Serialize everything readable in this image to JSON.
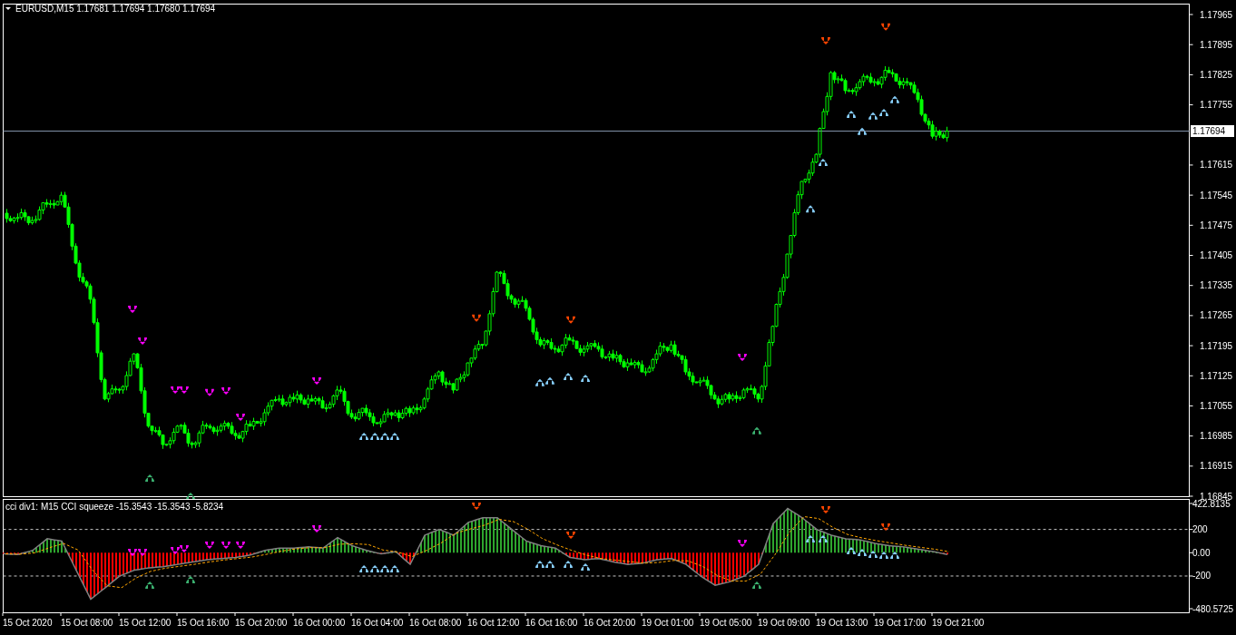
{
  "main_chart": {
    "title": "EURUSD,M15  1.17681 1.17694 1.17680 1.17694",
    "current_price": "1.17694",
    "price_axis": [
      "1.17965",
      "1.17895",
      "1.17825",
      "1.17755",
      "1.17615",
      "1.17545",
      "1.17475",
      "1.17405",
      "1.17335",
      "1.17265",
      "1.17195",
      "1.17125",
      "1.17055",
      "1.16985",
      "1.16915",
      "1.16845"
    ]
  },
  "indicator": {
    "title": "cci div1: M15 CCI squeeze -15.3543 -15.3543 -5.8234",
    "value_axis": [
      "422.8135",
      "200",
      "0.00",
      "-200",
      "-480.5725"
    ]
  },
  "time_axis": [
    "15 Oct 2020",
    "15 Oct 08:00",
    "15 Oct 12:00",
    "15 Oct 16:00",
    "15 Oct 20:00",
    "16 Oct 00:00",
    "16 Oct 04:00",
    "16 Oct 08:00",
    "16 Oct 12:00",
    "16 Oct 16:00",
    "16 Oct 20:00",
    "19 Oct 01:00",
    "19 Oct 05:00",
    "19 Oct 09:00",
    "19 Oct 13:00",
    "19 Oct 17:00",
    "19 Oct 21:00"
  ]
}
